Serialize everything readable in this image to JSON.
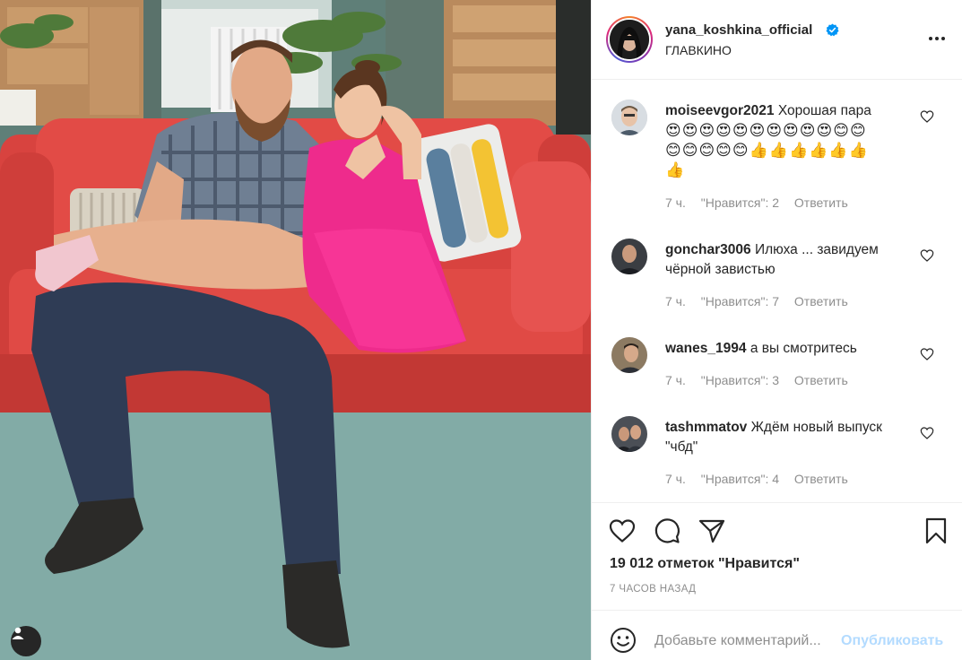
{
  "post": {
    "username": "yana_koshkina_official",
    "location": "ГЛАВКИНО",
    "likes_text": "19 012 отметок \"Нравится\"",
    "posted_ago": "7 ЧАСОВ НАЗАД"
  },
  "comments": [
    {
      "username": "moiseevgor2021",
      "text": "Хорошая пара",
      "emoji_line1": "😍😍😍😍😍😍😍😍😍😍😊😊",
      "emoji_line2": "😊😊😊😊😊👍👍👍👍👍👍",
      "emoji_line3": "👍",
      "time": "7 ч.",
      "likes": "\"Нравится\": 2",
      "reply": "Ответить"
    },
    {
      "username": "gonchar3006",
      "text": "Илюха ... завидуем чёрной завистью",
      "time": "7 ч.",
      "likes": "\"Нравится\": 7",
      "reply": "Ответить"
    },
    {
      "username": "wanes_1994",
      "text": "а вы смотритесь",
      "time": "7 ч.",
      "likes": "\"Нравится\": 3",
      "reply": "Ответить"
    },
    {
      "username": "tashmmatov",
      "text": "Ждём новый выпуск \"чбд\"",
      "time": "7 ч.",
      "likes": "\"Нравится\": 4",
      "reply": "Ответить"
    }
  ],
  "add_comment": {
    "placeholder": "Добавьте комментарий...",
    "publish_label": "Опубликовать"
  },
  "icons": {
    "like": "heart-icon",
    "comment": "comment-bubble-icon",
    "share": "paper-plane-icon",
    "save": "bookmark-icon",
    "more": "ellipsis-icon",
    "emoji": "smiley-icon",
    "tags": "user-tag-icon",
    "verified": "verified-badge-icon"
  },
  "colors": {
    "text": "#262626",
    "muted": "#8e8e8e",
    "border": "#efefef",
    "verified": "#0095f6",
    "publish_disabled": "#b3dbff"
  }
}
